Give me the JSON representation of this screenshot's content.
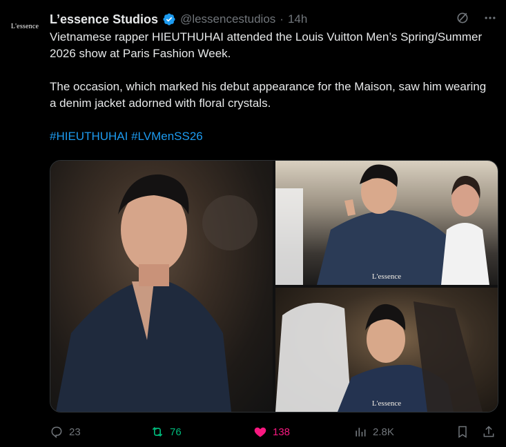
{
  "avatar": {
    "label": "L'essence"
  },
  "post": {
    "author_name": "L’essence Studios",
    "handle": "@lessencestudios",
    "separator": "·",
    "time": "14h",
    "paragraph1": "Vietnamese rapper HIEUTHUHAI attended the Louis Vuitton Men’s Spring/Summer 2026 show at Paris Fashion Week.",
    "paragraph2": "The occasion, which marked his debut appearance for the Maison, saw him wearing a denim jacket adorned with floral crystals.",
    "hashtags": [
      "#HIEUTHUHAI",
      "#LVMenSS26"
    ]
  },
  "media": {
    "watermark": "L'essence"
  },
  "stats": {
    "replies": "23",
    "reposts": "76",
    "likes": "138",
    "views": "2.8K"
  },
  "colors": {
    "background": "#000000",
    "text": "#e7e9ea",
    "muted": "#71767b",
    "link": "#1d9bf0",
    "repost": "#00ba7c",
    "like": "#f91880",
    "verified": "#1d9bf0"
  }
}
